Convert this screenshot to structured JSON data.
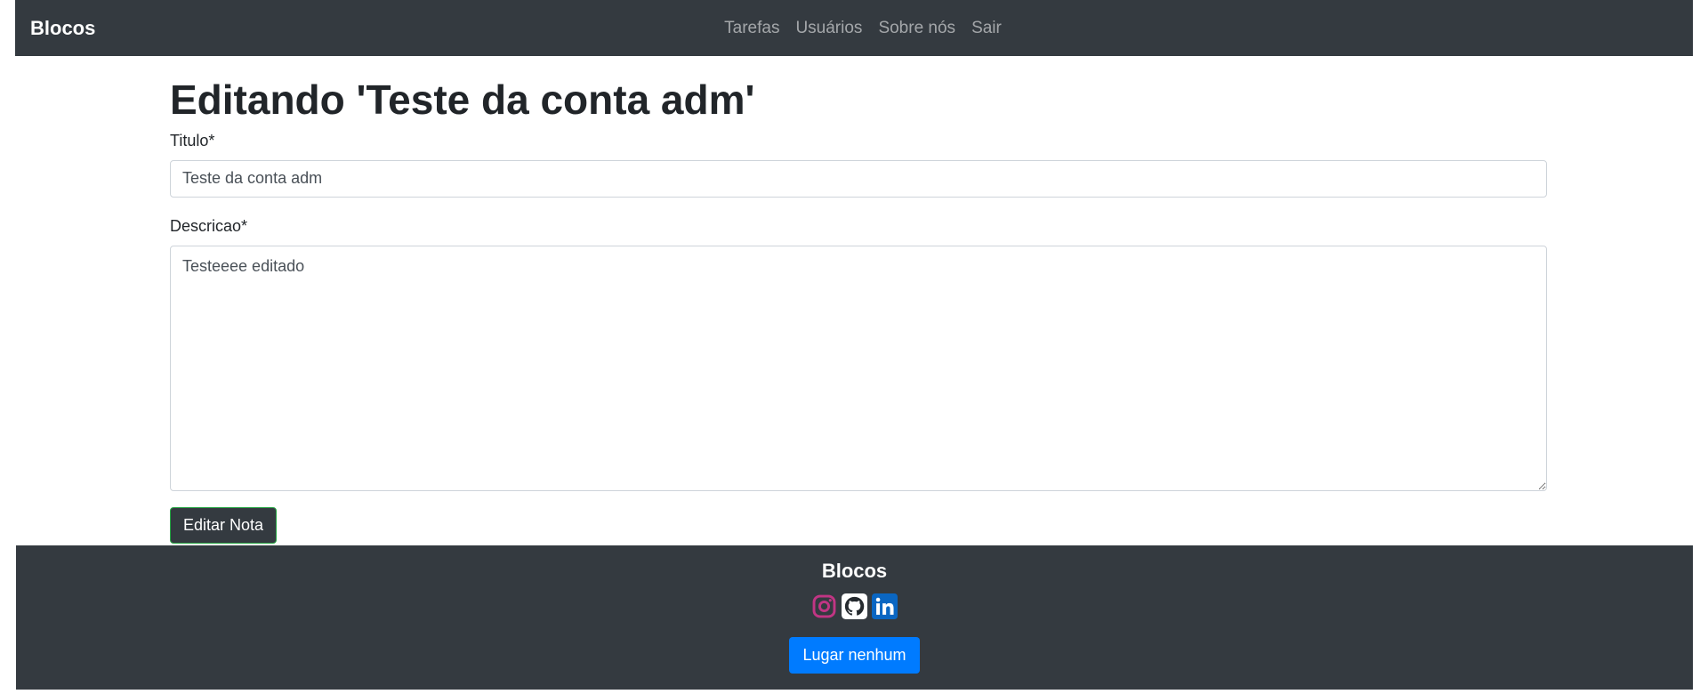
{
  "navbar": {
    "brand": "Blocos",
    "links": [
      "Tarefas",
      "Usuários",
      "Sobre nós",
      "Sair"
    ]
  },
  "page": {
    "title": "Editando 'Teste da conta adm'"
  },
  "form": {
    "title_label": "Titulo*",
    "title_value": "Teste da conta adm",
    "desc_label": "Descricao*",
    "desc_value": "Testeeee editado",
    "submit_label": "Editar Nota"
  },
  "footer": {
    "title": "Blocos",
    "social_icons": [
      "instagram-icon",
      "github-icon",
      "linkedin-icon"
    ],
    "button_label": "Lugar nenhum"
  },
  "colors": {
    "navbar_bg": "#343a40",
    "primary": "#007bff",
    "instagram": "#c13584",
    "linkedin": "#0a66c2",
    "success_border": "#28a745"
  }
}
